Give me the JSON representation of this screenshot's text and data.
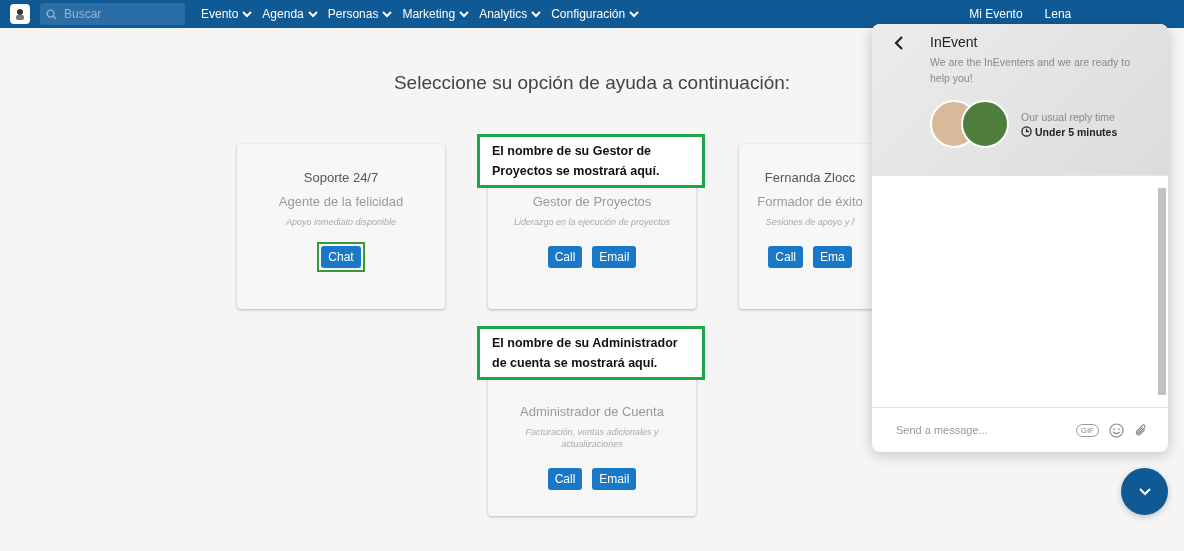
{
  "nav": {
    "search": {
      "placeholder": "Buscar"
    },
    "menus": [
      {
        "label": "Evento"
      },
      {
        "label": "Agenda"
      },
      {
        "label": "Personas"
      },
      {
        "label": "Marketing"
      },
      {
        "label": "Analytics"
      },
      {
        "label": "Configuración"
      }
    ],
    "user_menus": [
      {
        "label": "Mi Evento"
      },
      {
        "label": "Lena"
      }
    ]
  },
  "heading": "Seleccione su opción de ayuda a continuación:",
  "cards": [
    {
      "title": "Soporte 24/7",
      "subtitle": "Agente de la felicidad",
      "description": "Apoyo inmediato disponible",
      "buttons": [
        {
          "label": "Chat",
          "highlighted": true
        }
      ]
    },
    {
      "subtitle": "Gestor de Proyectos",
      "description": "Liderazgo en la ejecución de proyectos",
      "buttons": [
        {
          "label": "Call",
          "highlighted": false
        },
        {
          "label": "Email",
          "highlighted": false
        }
      ],
      "callout": "El nombre de su Gestor de Proyectos se mostrará aquí."
    },
    {
      "title": "Fernanda Zlocc",
      "subtitle": "Formador de éxito",
      "description": "Sesiones de apoyo y f",
      "buttons": [
        {
          "label": "Call",
          "highlighted": false
        },
        {
          "label": "Ema",
          "highlighted": false
        }
      ]
    },
    {
      "subtitle": "Administrador de Cuenta",
      "description": "Facturación, ventas adicionales y actualizaciones",
      "buttons": [
        {
          "label": "Call",
          "highlighted": false
        },
        {
          "label": "Email",
          "highlighted": false
        }
      ],
      "callout": "El nombre de su Administrador de cuenta se mostrará aquí."
    }
  ],
  "chat": {
    "title": "InEvent",
    "intro": "We are the InEventers and we are ready to help you!",
    "reply_label": "Our usual reply time",
    "reply_time": "Under 5 minutes",
    "input": {
      "placeholder": "Send a message..."
    },
    "gif": "GIF"
  }
}
